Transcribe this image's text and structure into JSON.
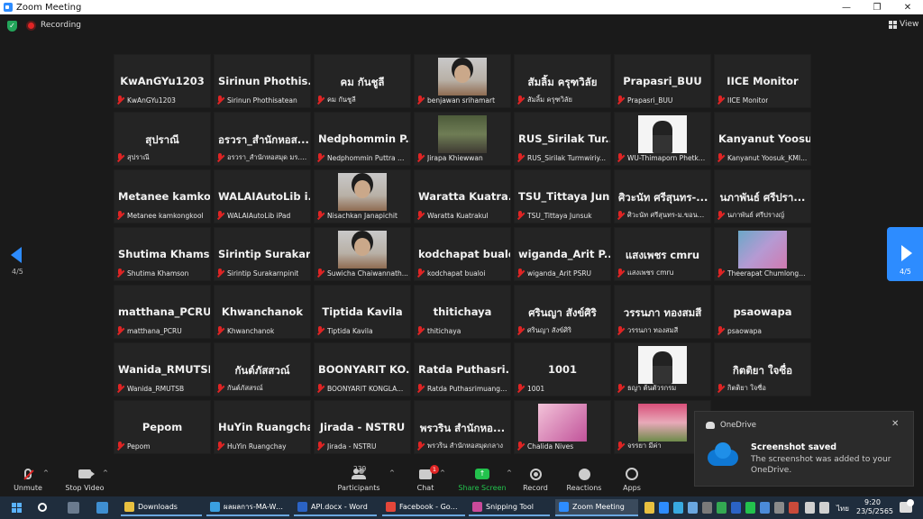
{
  "window": {
    "title": "Zoom Meeting",
    "minimize": "—",
    "maximize": "❐",
    "close": "✕"
  },
  "top": {
    "recording_label": "Recording",
    "view_label": "View"
  },
  "pager": {
    "left_label": "4/5",
    "right_label": "4/5"
  },
  "tiles": [
    {
      "big": "KwAnGYu1203",
      "small": "KwAnGYu1203"
    },
    {
      "big": "Sirinun  Phothis...",
      "small": "Sirinun Phothisatean"
    },
    {
      "big": "คม  กันชูลี",
      "small": "คม กันชูลี"
    },
    {
      "big": "",
      "small": "benjawan srihamart",
      "photo": "ph-person"
    },
    {
      "big": "สัมลิ้ม  ครุฑวิลัย",
      "small": "สัมลิ้ม ครุฑวิลัย"
    },
    {
      "big": "Prapasri_BUU",
      "small": "Prapasri_BUU"
    },
    {
      "big": "IICE Monitor",
      "small": "IICE Monitor"
    },
    {
      "big": "สุปราณี",
      "small": "สุปราณี"
    },
    {
      "big": "อรวรา_สำนักหอส...",
      "small": "อรวรา_สำนักหอสมุด มร.ชม."
    },
    {
      "big": "Nedphommin  P...",
      "small": "Nedphommin Puttra N..."
    },
    {
      "big": "",
      "small": "Jirapa Khiewwan",
      "photo": "ph-group"
    },
    {
      "big": "RUS_Sirilak  Tur...",
      "small": "RUS_Sirilak Turmwiriy..."
    },
    {
      "big": "",
      "small": "WU-Thimaporn Phetka...",
      "photo": "ph-suit"
    },
    {
      "big": "Kanyanut  Yoosu...",
      "small": "Kanyanut Yoosuk_KMI..."
    },
    {
      "big": "Metanee  kamko...",
      "small": "Metanee kamkongkool"
    },
    {
      "big": "WALAIAutoLib  i...",
      "small": "WALAIAutoLib iPad"
    },
    {
      "big": "",
      "small": "Nisachkan Janapichit",
      "photo": "ph-person"
    },
    {
      "big": "Waratta  Kuatra...",
      "small": "Waratta Kuatrakul"
    },
    {
      "big": "TSU_Tittaya  Jun...",
      "small": "TSU_Tittaya Junsuk"
    },
    {
      "big": "ศิวะนัท  ศรีสุนทร-...",
      "small": "ศิวะนัท ศรีสุนทร-ม.ขอนแก่น"
    },
    {
      "big": "นภาพันธ์  ศรีปรา...",
      "small": "นภาพันธ์ ศรีปรางญ์"
    },
    {
      "big": "Shutima  Khams...",
      "small": "Shutima Khamson"
    },
    {
      "big": "Sirintip  Surakar...",
      "small": "Sirintip Surakarnpinit"
    },
    {
      "big": "",
      "small": "Suwicha Chaiwannath...",
      "photo": "ph-person"
    },
    {
      "big": "kodchapat  bualoi",
      "small": "kodchapat bualoi"
    },
    {
      "big": "wiganda_Arit  P...",
      "small": "wiganda_Arit PSRU"
    },
    {
      "big": "แสงเพชร  cmru",
      "small": "แสงเพชร cmru"
    },
    {
      "big": "",
      "small": "Theerapat Chumlongpi...",
      "photo": "ph-slide"
    },
    {
      "big": "matthana_PCRU",
      "small": "matthana_PCRU"
    },
    {
      "big": "Khwanchanok",
      "small": "Khwanchanok"
    },
    {
      "big": "Tiptida  Kavila",
      "small": "Tiptida Kavila"
    },
    {
      "big": "thitichaya",
      "small": "thitichaya"
    },
    {
      "big": "ศรินญา  สังข์ศิริ",
      "small": "ศรินญา สังข์ศิริ"
    },
    {
      "big": "วรรนภา  ทองสมสี",
      "small": "วรรนภา ทองสมสี"
    },
    {
      "big": "psaowapa",
      "small": "psaowapa"
    },
    {
      "big": "Wanida_RMUTSB",
      "small": "Wanida_RMUTSB"
    },
    {
      "big": "กันต์ภัสสวณ์",
      "small": "กันต์ภัสสรณ์"
    },
    {
      "big": "BOONYARIT  KO...",
      "small": "BOONYARIT KONGLA..."
    },
    {
      "big": "Ratda  Puthasri...",
      "small": "Ratda Puthasrimuang (..."
    },
    {
      "big": "1001",
      "small": "1001"
    },
    {
      "big": "",
      "small": "ธญา ต้นตัวรกรม",
      "photo": "ph-suit"
    },
    {
      "big": "กิตติยา  ใจซื่อ",
      "small": "กิตติยา ใจซื่อ"
    },
    {
      "big": "Pepom",
      "small": "Pepom"
    },
    {
      "big": "HuYin  Ruangchay",
      "small": "HuYin Ruangchay"
    },
    {
      "big": "Jirada  -  NSTRU",
      "small": "Jirada - NSTRU"
    },
    {
      "big": "พรวริน  สำนักหอ...",
      "small": "พรวริน สำนักหอสมุดกลาง"
    },
    {
      "big": "",
      "small": "Chalida Nives",
      "photo": "ph-pink"
    },
    {
      "big": "",
      "small": "จรรยา มีค่า",
      "photo": "ph-flower"
    }
  ],
  "toolbar": {
    "unmute": "Unmute",
    "stop_video": "Stop Video",
    "participants": "Participants",
    "participants_count": "239",
    "chat": "Chat",
    "chat_badge": "1",
    "share_screen": "Share Screen",
    "record": "Record",
    "reactions": "Reactions",
    "apps": "Apps"
  },
  "toast": {
    "app": "OneDrive",
    "title": "Screenshot saved",
    "body": "The screenshot was added to your OneDrive."
  },
  "taskbar": {
    "apps": [
      {
        "label": "Downloads",
        "color": "#e8c040"
      },
      {
        "label": "ผลผลการ-MA-WAL...",
        "color": "#3aa0e0"
      },
      {
        "label": "API.docx - Word",
        "color": "#2b63c5"
      },
      {
        "label": "Facebook - Goo...",
        "color": "#e4463a"
      },
      {
        "label": "Snipping Tool",
        "color": "#c94a9a"
      },
      {
        "label": "Zoom Meeting",
        "color": "#2d8cff"
      }
    ],
    "lang": "ไทย",
    "time": "9:20",
    "date": "23/5/2565"
  },
  "colors": {
    "accent": "#2d8cff",
    "muted_red": "#e02424",
    "share_green": "#23c24d"
  }
}
